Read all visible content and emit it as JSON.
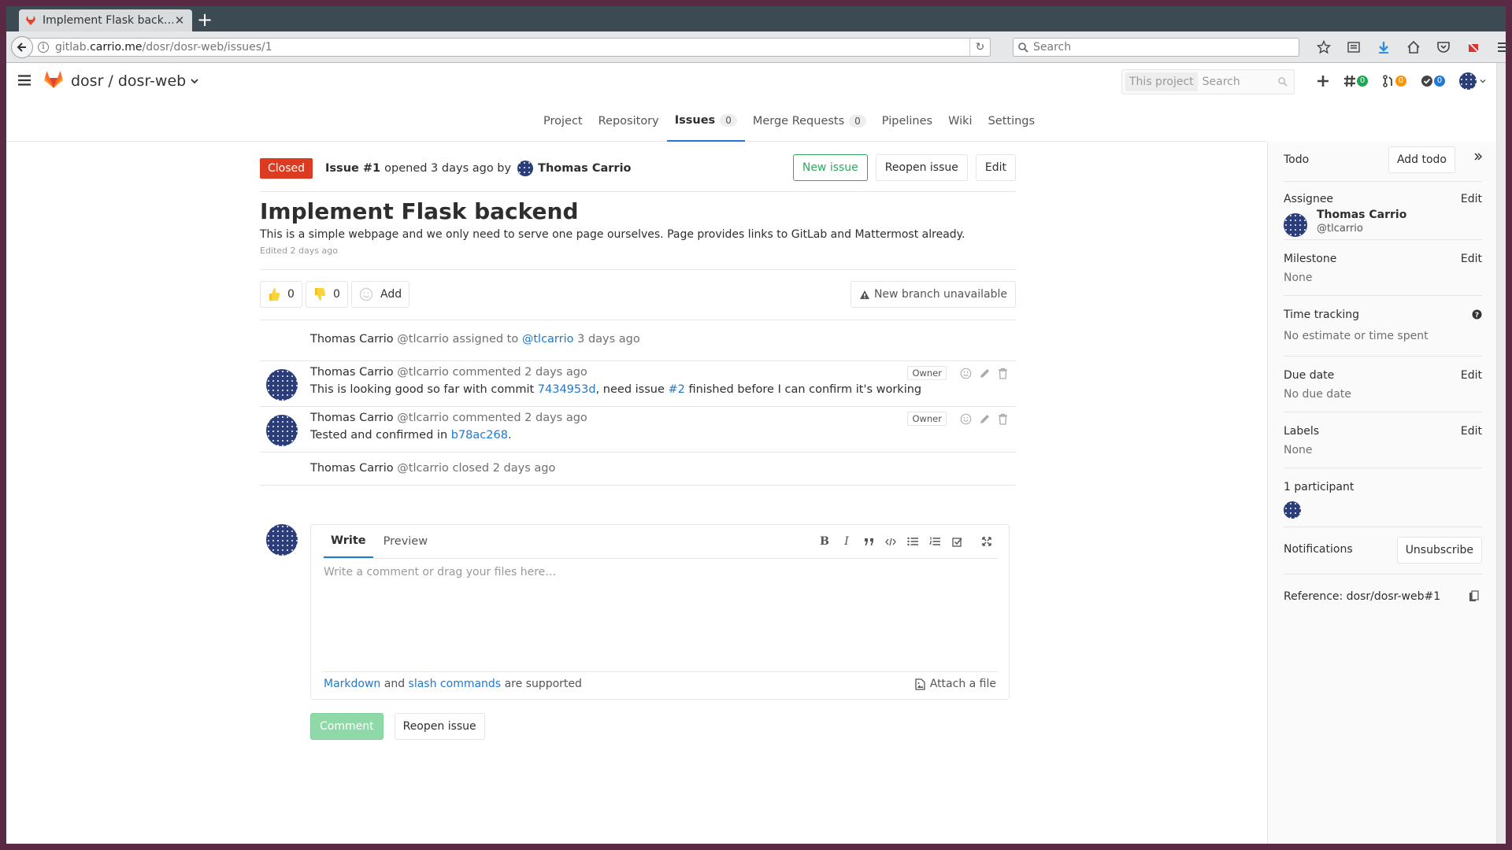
{
  "browser": {
    "tab_title": "Implement Flask back…",
    "url_prefix": "gitlab.",
    "url_host": "carrio.me",
    "url_path": "/dosr/dosr-web/issues/1",
    "search_placeholder": "Search"
  },
  "header": {
    "project_path": "dosr / dosr-web",
    "search_scope": "This project",
    "search_placeholder": "Search",
    "badges": {
      "issues": "0",
      "merge_requests": "0",
      "todos": "0"
    }
  },
  "subnav": {
    "items": [
      {
        "label": "Project"
      },
      {
        "label": "Repository"
      },
      {
        "label": "Issues",
        "count": "0"
      },
      {
        "label": "Merge Requests",
        "count": "0"
      },
      {
        "label": "Pipelines"
      },
      {
        "label": "Wiki"
      },
      {
        "label": "Settings"
      }
    ]
  },
  "issue": {
    "status": "Closed",
    "number": "Issue #1",
    "opened_text": "opened 3 days ago by",
    "author": "Thomas Carrio",
    "actions": {
      "new": "New issue",
      "reopen": "Reopen issue",
      "edit": "Edit"
    },
    "title": "Implement Flask backend",
    "description": "This is a simple webpage and we only need to serve one page ourselves. Page provides links to GitLab and Mattermost already.",
    "edited": "Edited 2 days ago",
    "awards": {
      "thumbsup": "0",
      "thumbsdown": "0",
      "add": "Add"
    },
    "new_branch": "New branch unavailable"
  },
  "notes": [
    {
      "author": "Thomas Carrio",
      "username": "@tlcarrio",
      "action": "assigned to",
      "target": "@tlcarrio",
      "time": "3 days ago"
    },
    {
      "author": "Thomas Carrio",
      "username": "@tlcarrio",
      "action": "commented",
      "time": "2 days ago",
      "role": "Owner",
      "body_1": "This is looking good so far with commit",
      "commit": "7434953d",
      "body_2": ", need issue",
      "issue_ref": "#2",
      "body_3": "finished before I can confirm it's working"
    },
    {
      "author": "Thomas Carrio",
      "username": "@tlcarrio",
      "action": "commented",
      "time": "2 days ago",
      "role": "Owner",
      "body_1": "Tested and confirmed in",
      "commit": "b78ac268",
      "body_2": "."
    },
    {
      "author": "Thomas Carrio",
      "username": "@tlcarrio",
      "action": "closed",
      "time": "2 days ago"
    }
  ],
  "comment_form": {
    "tab_write": "Write",
    "tab_preview": "Preview",
    "placeholder": "Write a comment or drag your files here…",
    "markdown": "Markdown",
    "and": "and",
    "slash": "slash commands",
    "supported": "are supported",
    "attach": "Attach a file",
    "comment_btn": "Comment",
    "reopen_btn": "Reopen issue"
  },
  "sidebar": {
    "todo_label": "Todo",
    "add_todo": "Add todo",
    "assignee_label": "Assignee",
    "edit": "Edit",
    "assignee_name": "Thomas Carrio",
    "assignee_username": "@tlcarrio",
    "milestone_label": "Milestone",
    "milestone_value": "None",
    "time_label": "Time tracking",
    "time_value": "No estimate or time spent",
    "due_label": "Due date",
    "due_value": "No due date",
    "labels_label": "Labels",
    "labels_value": "None",
    "participants": "1 participant",
    "notifications_label": "Notifications",
    "unsubscribe": "Unsubscribe",
    "reference": "Reference: dosr/dosr-web#1"
  },
  "colors": {
    "closed_badge": "#db3b21",
    "link": "#1f78d1",
    "active_tab_underline": "#1f78d1",
    "new_issue_green": "#2faa60"
  }
}
